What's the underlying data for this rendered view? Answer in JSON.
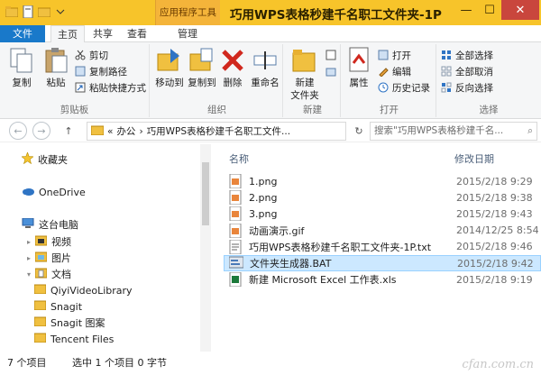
{
  "window": {
    "title": "巧用WPS表格秒建千名职工文件夹-1P",
    "context_tab": "应用程序工具",
    "controls": {
      "minimize": "—",
      "maximize": "☐",
      "close": "✕"
    }
  },
  "tabs": [
    "文件",
    "主页",
    "共享",
    "查看",
    "管理"
  ],
  "ribbon": {
    "clipboard": {
      "label": "剪贴板",
      "copy": "复制",
      "paste": "粘贴",
      "cut": "剪切",
      "copy_path": "复制路径",
      "paste_shortcut": "粘贴快捷方式"
    },
    "organize": {
      "label": "组织",
      "move_to": "移动到",
      "copy_to": "复制到",
      "delete": "删除",
      "rename": "重命名"
    },
    "new": {
      "label": "新建",
      "new_folder_line1": "新建",
      "new_folder_line2": "文件夹"
    },
    "open": {
      "label": "打开",
      "properties": "属性",
      "open": "打开",
      "edit": "编辑",
      "history": "历史记录"
    },
    "select": {
      "label": "选择",
      "select_all": "全部选择",
      "select_none": "全部取消",
      "invert": "反向选择"
    }
  },
  "address": {
    "back": "←",
    "forward": "→",
    "up": "↑",
    "sep": "«",
    "crumbs": [
      "办公",
      "巧用WPS表格秒建千名职工文件..."
    ],
    "search_placeholder": "搜索\"巧用WPS表格秒建千名...",
    "refresh": "↻"
  },
  "nav": {
    "favorites": "收藏夹",
    "onedrive": "OneDrive",
    "this_pc": "这台电脑",
    "videos": "视频",
    "pictures": "图片",
    "documents": "文档",
    "sub": [
      "QiyiVideoLibrary",
      "Snagit",
      "Snagit 图案",
      "Tencent Files"
    ]
  },
  "columns": {
    "name": "名称",
    "modified": "修改日期"
  },
  "files": [
    {
      "name": "1.png",
      "date": "2015/2/18 9:29",
      "type": "png"
    },
    {
      "name": "2.png",
      "date": "2015/2/18 9:38",
      "type": "png"
    },
    {
      "name": "3.png",
      "date": "2015/2/18 9:43",
      "type": "png"
    },
    {
      "name": "动画演示.gif",
      "date": "2014/12/25 8:54",
      "type": "gif"
    },
    {
      "name": "巧用WPS表格秒建千名职工文件夹-1P.txt",
      "date": "2015/2/18 9:46",
      "type": "txt"
    },
    {
      "name": "文件夹生成器.BAT",
      "date": "2015/2/18 9:42",
      "type": "bat"
    },
    {
      "name": "新建 Microsoft Excel 工作表.xls",
      "date": "2015/2/18 9:19",
      "type": "xls"
    }
  ],
  "status": {
    "count": "7 个项目",
    "selected": "选中 1 个项目 0 字节"
  },
  "watermark": "cfan.com.cn",
  "colors": {
    "titlebar": "#f7c42a",
    "file_tab": "#1979ca",
    "selection": "#cce8ff"
  }
}
